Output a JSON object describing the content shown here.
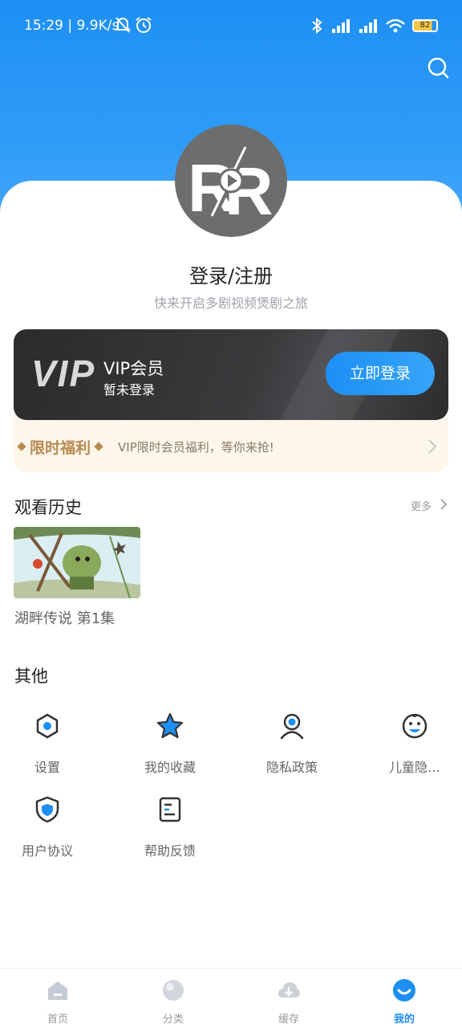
{
  "status_bar": {
    "time": "15:29",
    "speed": "9.9K/s",
    "battery": "82"
  },
  "profile": {
    "login_title": "登录/注册",
    "login_subtitle": "快来开启多剧视频煲剧之旅"
  },
  "vip": {
    "logo": "VIP",
    "title": "VIP会员",
    "status": "暂未登录",
    "button": "立即登录",
    "benefit_badge": "限时福利",
    "benefit_desc": "VIP限时会员福利，等你来抢!"
  },
  "history": {
    "title": "观看历史",
    "more": "更多",
    "items": [
      {
        "title": "湖畔传说 第1集"
      }
    ]
  },
  "other": {
    "title": "其他",
    "items": [
      {
        "label": "设置",
        "icon": "hexagon-settings-icon"
      },
      {
        "label": "我的收藏",
        "icon": "star-icon"
      },
      {
        "label": "隐私政策",
        "icon": "user-privacy-icon"
      },
      {
        "label": "儿童隐…",
        "icon": "child-face-icon"
      },
      {
        "label": "用户协议",
        "icon": "shield-icon"
      },
      {
        "label": "帮助反馈",
        "icon": "document-icon"
      }
    ]
  },
  "tabbar": {
    "tabs": [
      {
        "label": "首页",
        "icon": "home-icon"
      },
      {
        "label": "分类",
        "icon": "category-icon"
      },
      {
        "label": "缓存",
        "icon": "download-cloud-icon"
      },
      {
        "label": "我的",
        "icon": "profile-smile-icon",
        "active": true
      }
    ]
  },
  "colors": {
    "accent": "#1e8ff4",
    "vip_gold": "#b88a50"
  }
}
